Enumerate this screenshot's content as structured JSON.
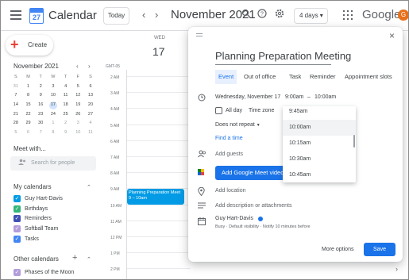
{
  "header": {
    "app_title": "Calendar",
    "logo_number": "27",
    "today_label": "Today",
    "prev": "‹",
    "next": "›",
    "month_title": "November 2021",
    "view_label": "4 days ▾",
    "google_word": "Google",
    "avatar_letter": "G"
  },
  "sidebar": {
    "create_label": "Create",
    "mini_calendar": {
      "title": "November 2021",
      "prev": "‹",
      "next": "›",
      "weekday_headers": [
        "S",
        "M",
        "T",
        "W",
        "T",
        "F",
        "S"
      ],
      "weeks": [
        [
          "31",
          "1",
          "2",
          "3",
          "4",
          "5",
          "6"
        ],
        [
          "7",
          "8",
          "9",
          "10",
          "11",
          "12",
          "13"
        ],
        [
          "14",
          "15",
          "16",
          "17",
          "18",
          "19",
          "20"
        ],
        [
          "21",
          "22",
          "23",
          "24",
          "25",
          "26",
          "27"
        ],
        [
          "28",
          "29",
          "30",
          "1",
          "2",
          "3",
          "4"
        ],
        [
          "5",
          "6",
          "7",
          "8",
          "9",
          "10",
          "11"
        ]
      ],
      "selected_day": "17"
    },
    "meet_with_label": "Meet with...",
    "search_people_placeholder": "Search for people",
    "my_calendars_label": "My calendars",
    "my_calendars": [
      {
        "label": "Guy Hart-Davis",
        "color": "#039be5"
      },
      {
        "label": "Birthdays",
        "color": "#33b679"
      },
      {
        "label": "Reminders",
        "color": "#3f51b5"
      },
      {
        "label": "Softball Team",
        "color": "#b39ddb"
      },
      {
        "label": "Tasks",
        "color": "#4285f4"
      }
    ],
    "other_calendars_label": "Other calendars",
    "other_calendars": [
      {
        "label": "Phases of the Moon",
        "color": "#b39ddb"
      }
    ]
  },
  "day_column": {
    "weekday": "WED",
    "date": "17",
    "timezone": "GMT-05",
    "time_labels": [
      "2 AM",
      "3 AM",
      "4 AM",
      "5 AM",
      "6 AM",
      "7 AM",
      "8 AM",
      "9 AM",
      "10 AM",
      "11 AM",
      "12 PM",
      "1 PM",
      "2 PM"
    ],
    "event": {
      "title": "Planning Preparation Meet",
      "time": "9 – 10am",
      "color": "#039be5"
    }
  },
  "dialog": {
    "title": "Planning Preparation Meeting",
    "tabs": [
      "Event",
      "Out of office",
      "Task",
      "Reminder",
      "Appointment slots"
    ],
    "active_tab": "Event",
    "date_text": "Wednesday, November 17",
    "start_time": "9:00am",
    "dash": "–",
    "end_time": "10:00am",
    "all_day_label": "All day",
    "timezone_label": "Time zone",
    "repeat_label": "Does not repeat",
    "find_time_label": "Find a time",
    "add_guests_label": "Add guests",
    "meet_button_label": "Add Google Meet video",
    "add_location_label": "Add location",
    "add_description_label": "Add description or attachments",
    "owner_name": "Guy Hart-Davis",
    "owner_details": "Busy · Default visibility · Notify 10 minutes before",
    "more_options_label": "More options",
    "save_label": "Save",
    "time_dropdown": [
      "9:45am",
      "10:00am",
      "10:15am",
      "10:30am",
      "10:45am"
    ],
    "time_dropdown_selected": "10:00am"
  }
}
